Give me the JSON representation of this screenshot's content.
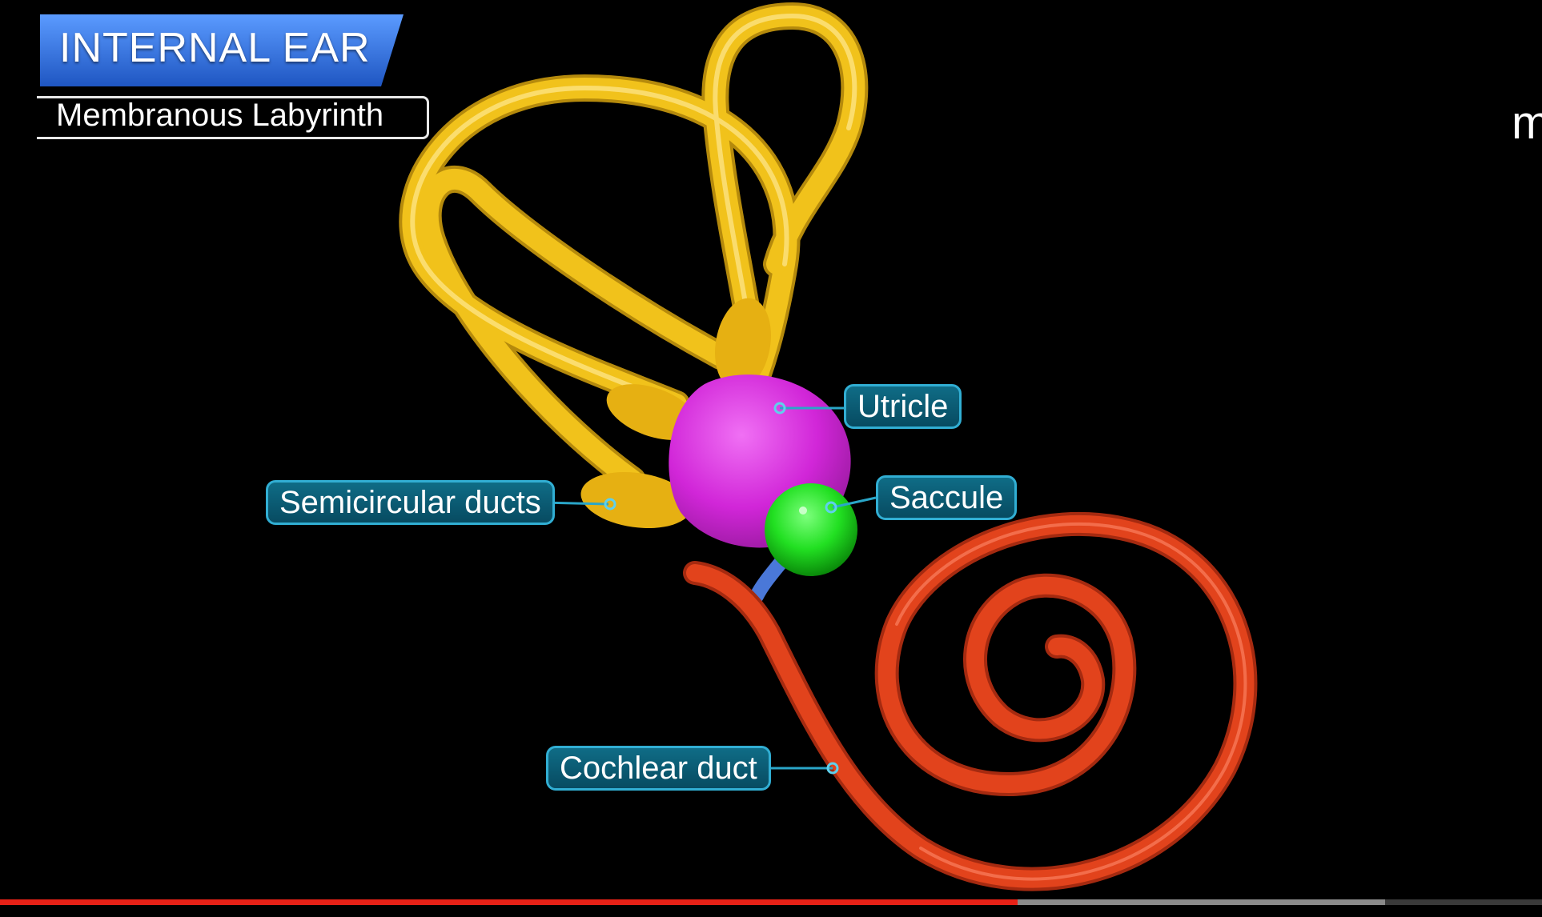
{
  "header": {
    "title": "INTERNAL EAR",
    "subtitle": "Membranous Labyrinth"
  },
  "edge_logo": "m",
  "labels": {
    "utricle": "Utricle",
    "saccule": "Saccule",
    "semicircular_ducts": "Semicircular ducts",
    "cochlear_duct": "Cochlear duct"
  },
  "colors": {
    "semicircular_ducts": "#f1c21b",
    "utricle": "#d126d8",
    "saccule": "#22e022",
    "cochlear_duct": "#e2431c",
    "ductus_reuniens": "#4a78d8",
    "label_fill": "#0b5a73",
    "label_border": "#31aed3",
    "title_banner": "#2f6fd6",
    "progress_played": "#e62117"
  },
  "video_progress": {
    "played_fraction": 0.66,
    "buffered_fraction": 0.898
  }
}
